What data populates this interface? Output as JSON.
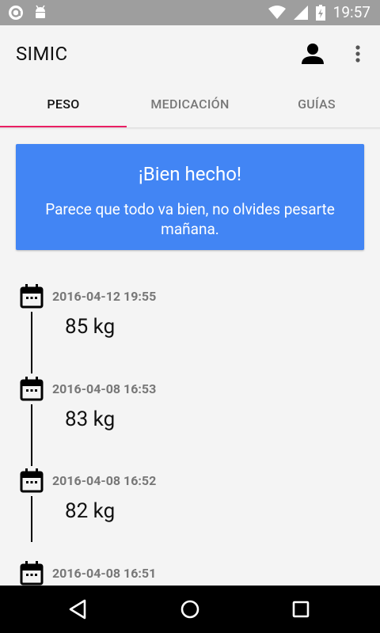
{
  "status_bar": {
    "time": "19:57"
  },
  "app": {
    "title": "SIMIC"
  },
  "tabs": [
    {
      "label": "PESO",
      "active": true
    },
    {
      "label": "MEDICACIÓN",
      "active": false
    },
    {
      "label": "GUÍAS",
      "active": false
    }
  ],
  "banner": {
    "heading": "¡Bien hecho!",
    "message": "Parece que todo va bien, no olvides pesarte mañana."
  },
  "entries": [
    {
      "date": "2016-04-12 19:55",
      "weight": "85 kg"
    },
    {
      "date": "2016-04-08 16:53",
      "weight": "83 kg"
    },
    {
      "date": "2016-04-08 16:52",
      "weight": "82 kg"
    },
    {
      "date": "2016-04-08 16:51",
      "weight": ""
    }
  ],
  "colors": {
    "accent": "#e91e63",
    "banner": "#4285f4"
  }
}
